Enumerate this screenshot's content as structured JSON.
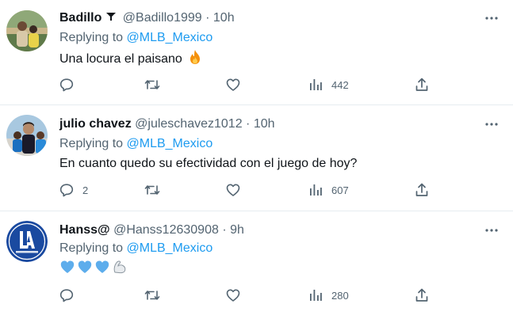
{
  "tweets": [
    {
      "name": "Badillo",
      "verified": true,
      "handle": "@Badillo1999",
      "sep": "·",
      "time": "10h",
      "replying_prefix": "Replying to",
      "replying_to": "@MLB_Mexico",
      "text": "Una locura el paisano",
      "emoji": "fire",
      "reply_count": "",
      "retweet_count": "",
      "like_count": "",
      "views": "442"
    },
    {
      "name": "julio chavez",
      "verified": false,
      "handle": "@juleschavez1012",
      "sep": "·",
      "time": "10h",
      "replying_prefix": "Replying to",
      "replying_to": "@MLB_Mexico",
      "text": "En cuanto quedo su efectividad con el juego de hoy?",
      "reply_count": "2",
      "retweet_count": "",
      "like_count": "",
      "views": "607"
    },
    {
      "name": "Hanss@",
      "verified": false,
      "handle": "@Hanss12630908",
      "sep": "·",
      "time": "9h",
      "replying_prefix": "Replying to",
      "replying_to": "@MLB_Mexico",
      "emojis": [
        "blue-heart",
        "blue-heart",
        "blue-heart",
        "flexed-biceps"
      ],
      "reply_count": "",
      "retweet_count": "",
      "like_count": "",
      "views": "280"
    }
  ],
  "colors": {
    "link": "#1d9bf0",
    "muted": "#536471",
    "text": "#0f1419",
    "divider": "#e6ecf0"
  }
}
